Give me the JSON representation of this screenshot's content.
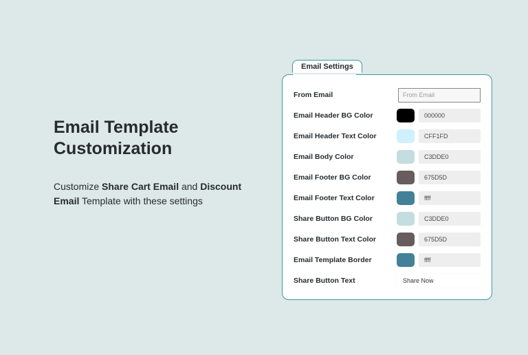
{
  "left": {
    "heading_line1": "Email Template",
    "heading_line2": "Customization",
    "sub_pre": "Customize ",
    "sub_bold1": "Share Cart Email",
    "sub_mid": " and ",
    "sub_bold2": "Discount Email",
    "sub_post": " Template with these settings"
  },
  "panel": {
    "tab_label": "Email Settings",
    "rows": {
      "from_email": {
        "label": "From Email",
        "placeholder": "From Email"
      },
      "header_bg": {
        "label": "Email Header BG Color",
        "swatch": "#000000",
        "value": "000000"
      },
      "header_text": {
        "label": "Email Header Text Color",
        "swatch": "#CFF1FD",
        "value": "CFF1FD"
      },
      "body": {
        "label": "Email Body Color",
        "swatch": "#C3DDE0",
        "value": "C3DDE0"
      },
      "footer_bg": {
        "label": "Email Footer BG Color",
        "swatch": "#675D5D",
        "value": "675D5D"
      },
      "footer_text": {
        "label": "Email Footer Text Color",
        "swatch": "#428197",
        "value": "ffff"
      },
      "share_bg": {
        "label": "Share Button BG Color",
        "swatch": "#C3DDE0",
        "value": "C3DDE0"
      },
      "share_text": {
        "label": "Share Button Text Color",
        "swatch": "#675D5D",
        "value": "675D5D"
      },
      "border": {
        "label": "Email Template Border",
        "swatch": "#428197",
        "value": "ffff"
      },
      "button_text": {
        "label": "Share Button Text",
        "value": "Share Now"
      }
    }
  }
}
